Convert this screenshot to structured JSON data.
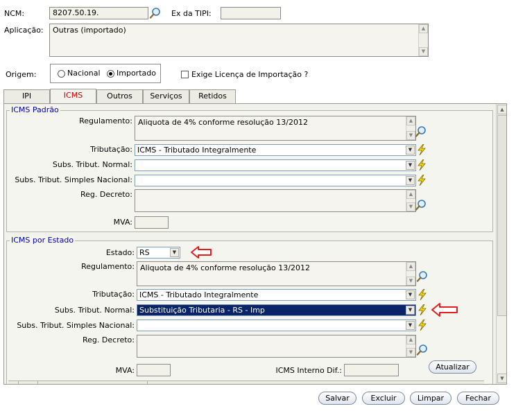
{
  "header": {
    "ncm_label": "NCM:",
    "ncm_value": "8207.50.19.",
    "ex_tipi_label": "Ex da TIPI:",
    "ex_tipi_value": "",
    "aplicacao_label": "Aplicação:",
    "aplicacao_value": "Outras (importado)",
    "origem_label": "Origem:",
    "origem_nacional": "Nacional",
    "origem_importado": "Importado",
    "origem_selected": "Importado",
    "licenca_label": "Exige Licença de Importação ?"
  },
  "tabs": [
    {
      "label": "IPI"
    },
    {
      "label": "ICMS"
    },
    {
      "label": "Outros"
    },
    {
      "label": "Serviços"
    },
    {
      "label": "Retidos"
    }
  ],
  "icms_padrao": {
    "legend": "ICMS Padrão",
    "regulamento_label": "Regulamento:",
    "regulamento_value": "Aliquota de 4% conforme resolução 13/2012",
    "tributacao_label": "Tributação:",
    "tributacao_value": "ICMS - Tributado Integralmente",
    "subs_normal_label": "Subs. Tribut. Normal:",
    "subs_normal_value": "",
    "subs_simples_label": "Subs. Tribut. Simples Nacional:",
    "subs_simples_value": "",
    "reg_decreto_label": "Reg. Decreto:",
    "reg_decreto_value": "",
    "mva_label": "MVA:",
    "mva_value": ""
  },
  "icms_estado": {
    "legend": "ICMS por Estado",
    "estado_label": "Estado:",
    "estado_value": "RS",
    "regulamento_label": "Regulamento:",
    "regulamento_value": "Aliquota de 4% conforme resolução 13/2012",
    "tributacao_label": "Tributação:",
    "tributacao_value": "ICMS - Tributado Integralmente",
    "subs_normal_label": "Subs. Tribut. Normal:",
    "subs_normal_value": "Substituição Tributaria - RS - Imp",
    "subs_simples_label": "Subs. Tribut. Simples Nacional:",
    "subs_simples_value": "",
    "reg_decreto_label": "Reg. Decreto:",
    "reg_decreto_value": "",
    "mva_label": "MVA:",
    "mva_value": "",
    "icms_interno_label": "ICMS Interno Dif.:",
    "icms_interno_value": "",
    "atualizar_label": "Atualizar"
  },
  "footer": {
    "salvar": "Salvar",
    "excluir": "Excluir",
    "limpar": "Limpar",
    "fechar": "Fechar"
  },
  "colors": {
    "legend": "#0000aa",
    "active_tab": "#cc0000",
    "highlight": "#0a246a",
    "arrow_annotation": "#e02020",
    "bolt": "#f5d800"
  },
  "icons": [
    "magnifier-icon",
    "lightning-icon",
    "red-arrow-annotation"
  ]
}
